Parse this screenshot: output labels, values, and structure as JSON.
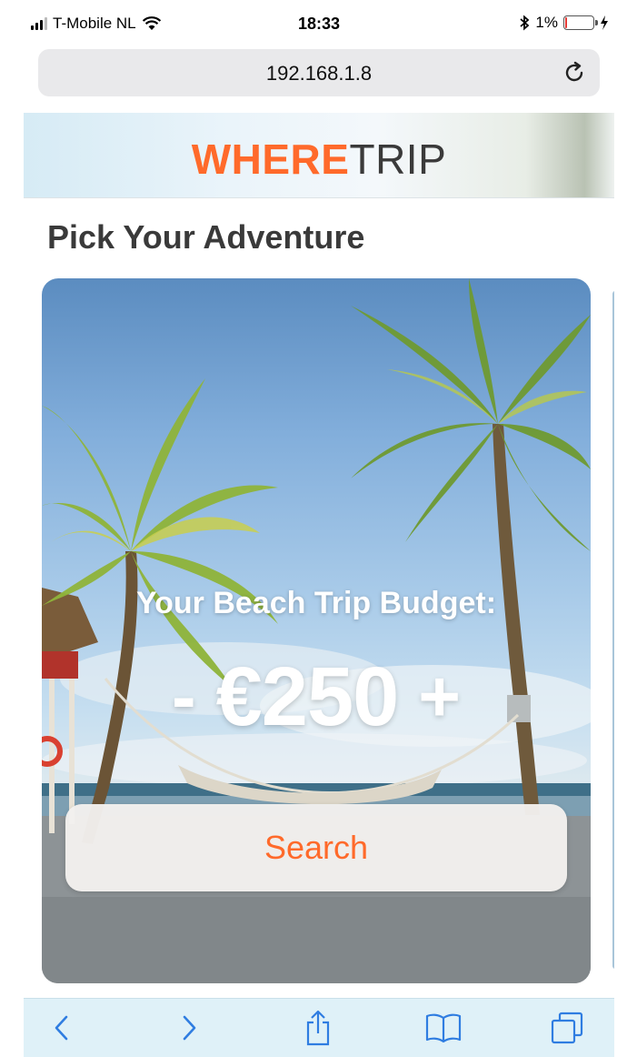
{
  "status_bar": {
    "carrier": "T-Mobile NL",
    "time": "18:33",
    "battery_text": "1%",
    "battery_level": 0.01
  },
  "browser": {
    "url": "192.168.1.8"
  },
  "site": {
    "logo_part1": "WHERE",
    "logo_part2": "TRIP",
    "accent_color": "#ff6a2b"
  },
  "page": {
    "title": "Pick Your Adventure"
  },
  "card": {
    "budget_label": "Your Beach Trip Budget:",
    "decrease_label": "-",
    "budget_value": "€250",
    "increase_label": "+",
    "search_label": "Search"
  },
  "toolbar": {
    "icons": [
      "back-icon",
      "forward-icon",
      "share-icon",
      "bookmarks-icon",
      "tabs-icon"
    ]
  }
}
